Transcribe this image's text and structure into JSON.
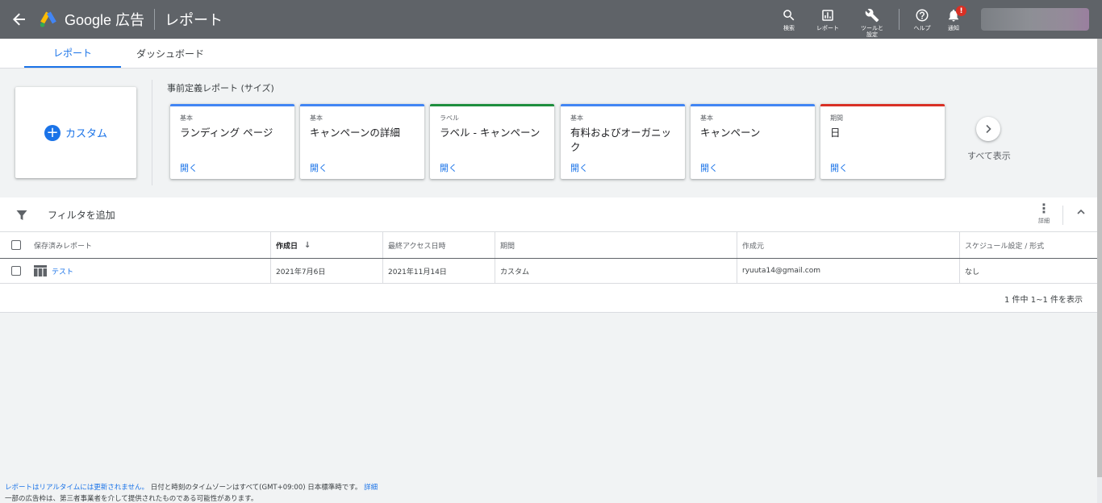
{
  "header": {
    "brand": "Google 広告",
    "page_title": "レポート",
    "tools": [
      {
        "icon": "search-icon",
        "label": "検索"
      },
      {
        "icon": "reports-icon",
        "label": "レポート"
      },
      {
        "icon": "wrench-icon",
        "label": "ツールと設定"
      },
      {
        "icon": "help-icon",
        "label": "ヘルプ"
      },
      {
        "icon": "bell-icon",
        "label": "通知",
        "badge": "!"
      }
    ]
  },
  "tabs": [
    {
      "label": "レポート",
      "active": true
    },
    {
      "label": "ダッシュボード",
      "active": false
    }
  ],
  "predefined": {
    "custom_label": "カスタム",
    "section_title": "事前定義レポート (サイズ)",
    "cards": [
      {
        "category": "基本",
        "name": "ランディング ページ",
        "open": "開く",
        "color": "#4285f4"
      },
      {
        "category": "基本",
        "name": "キャンペーンの詳細",
        "open": "開く",
        "color": "#4285f4"
      },
      {
        "category": "ラベル",
        "name": "ラベル - キャンペーン",
        "open": "開く",
        "color": "#1e8e3e"
      },
      {
        "category": "基本",
        "name": "有料およびオーガニック",
        "open": "開く",
        "color": "#4285f4"
      },
      {
        "category": "基本",
        "name": "キャンペーン",
        "open": "開く",
        "color": "#4285f4"
      },
      {
        "category": "期間",
        "name": "日",
        "open": "開く",
        "color": "#d93025"
      }
    ],
    "view_all": "すべて表示"
  },
  "filter": {
    "add_filter": "フィルタを追加",
    "more_label": "詳細"
  },
  "table": {
    "columns": [
      "保存済みレポート",
      "作成日",
      "最終アクセス日時",
      "期間",
      "作成元",
      "スケジュール設定 / 形式"
    ],
    "rows": [
      {
        "name": "テスト",
        "created": "2021年7月6日",
        "last_access": "2021年11月14日",
        "period": "カスタム",
        "owner": "ryuuta14@gmail.com",
        "schedule": "なし"
      }
    ],
    "pagination": "1 件中 1~1 件を表示"
  },
  "footer": {
    "line1_link": "レポートはリアルタイムには更新されません。",
    "line1_text": "日付と時刻のタイムゾーンはすべて(GMT+09:00) 日本標準時です。",
    "line1_more": "詳細",
    "line2": "一部の広告枠は、第三者事業者を介して提供されたものである可能性があります。"
  }
}
